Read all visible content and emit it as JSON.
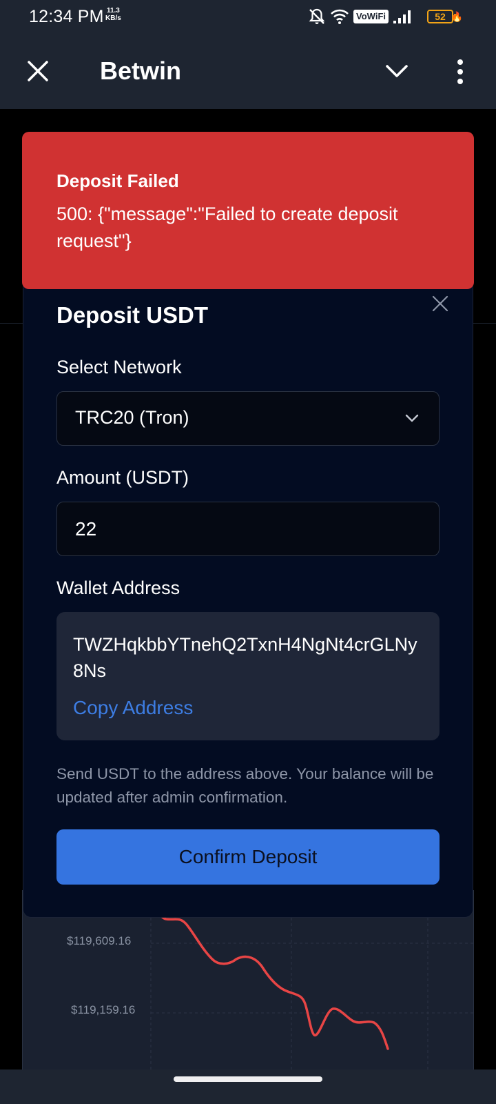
{
  "status_bar": {
    "time": "12:34 PM",
    "speed_value": "11.3",
    "speed_unit": "KB/s",
    "vowifi": "VoWiFi",
    "battery": "52"
  },
  "app_bar": {
    "title": "Betwin"
  },
  "toast": {
    "title": "Deposit Failed",
    "message": "500: {\"message\":\"Failed to create deposit request\"}",
    "color": "#d03232"
  },
  "modal": {
    "title": "Deposit USDT",
    "network_label": "Select Network",
    "network_value": "TRC20 (Tron)",
    "amount_label": "Amount (USDT)",
    "amount_value": "22",
    "wallet_label": "Wallet Address",
    "wallet_address": "TWZHqkbbYTnehQ2TxnH4NgNt4crGLNy8Ns",
    "copy_label": "Copy Address",
    "help_text": "Send USDT to the address above. Your balance will be updated after admin confirmation.",
    "confirm_label": "Confirm Deposit",
    "accent_color": "#3574e0"
  },
  "background_chart": {
    "price_labels": [
      "$119,609.16",
      "$119,159.16"
    ],
    "line_color": "#e84545"
  }
}
